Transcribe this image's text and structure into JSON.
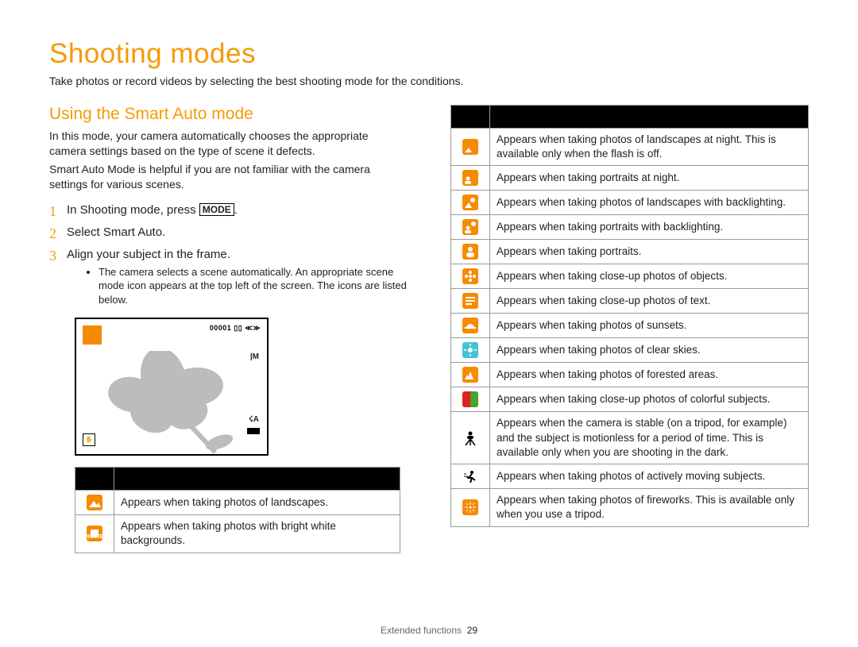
{
  "title": "Shooting modes",
  "subtitle": "Take photos or record videos by selecting the best shooting mode for the conditions.",
  "section": "Using the Smart Auto mode",
  "para1": "In this mode, your camera automatically chooses the appropriate camera settings based on the type of scene it defects.",
  "para2": "Smart Auto Mode is helpful if you are not familiar with the camera settings for various scenes.",
  "steps": {
    "s1a": "In Shooting mode, press ",
    "s1b": "MODE",
    "s1c": ".",
    "s2": "Select Smart Auto.",
    "s3": "Align your subject in the frame.",
    "bullet": "The camera selects a scene automatically. An appropriate scene mode icon appears at the top left of the screen. The icons are listed below."
  },
  "screen": {
    "top_status": "00001 ▯▯ ≪≫",
    "right1": "|M",
    "right2": "☇A",
    "bl": "✋"
  },
  "table_left": [
    {
      "icon_name": "landscape-icon",
      "icon_class": "ico-orange",
      "svg_kind": "landscape",
      "desc": "Appears when taking photos of landscapes."
    },
    {
      "icon_name": "white-bg-icon",
      "icon_class": "ico-orange",
      "svg_kind": "white",
      "desc": "Appears when taking photos with bright white backgrounds."
    }
  ],
  "table_right": [
    {
      "icon_name": "night-landscape-icon",
      "icon_class": "ico-orange",
      "svg_kind": "moon-landscape",
      "desc": "Appears when taking photos of landscapes at night. This is available only when the flash is off."
    },
    {
      "icon_name": "night-portrait-icon",
      "icon_class": "ico-orange",
      "svg_kind": "moon-portrait",
      "desc": "Appears when taking portraits at night."
    },
    {
      "icon_name": "backlight-landscape-icon",
      "icon_class": "ico-orange",
      "svg_kind": "sun-landscape",
      "desc": "Appears when taking photos of landscapes with backlighting."
    },
    {
      "icon_name": "backlight-portrait-icon",
      "icon_class": "ico-orange",
      "svg_kind": "sun-portrait",
      "desc": "Appears when taking portraits with backlighting."
    },
    {
      "icon_name": "portrait-icon",
      "icon_class": "ico-orange",
      "svg_kind": "portrait",
      "desc": "Appears when taking portraits."
    },
    {
      "icon_name": "macro-object-icon",
      "icon_class": "ico-orange",
      "svg_kind": "flower",
      "desc": "Appears when taking close-up photos of objects."
    },
    {
      "icon_name": "macro-text-icon",
      "icon_class": "ico-orange",
      "svg_kind": "text",
      "desc": "Appears when taking close-up photos of text."
    },
    {
      "icon_name": "sunset-icon",
      "icon_class": "ico-orange",
      "svg_kind": "sunset",
      "desc": "Appears when taking photos of sunsets."
    },
    {
      "icon_name": "clear-sky-icon",
      "icon_class": "ico-cyan",
      "svg_kind": "sky",
      "desc": "Appears when taking photos of clear skies."
    },
    {
      "icon_name": "forest-icon",
      "icon_class": "ico-orange",
      "svg_kind": "forest",
      "desc": "Appears when taking photos of forested areas."
    },
    {
      "icon_name": "macro-color-icon",
      "icon_class": "ico-green",
      "svg_kind": "",
      "desc": "Appears when taking close-up photos of colorful subjects."
    },
    {
      "icon_name": "tripod-icon",
      "icon_class": "ico-plain",
      "svg_kind": "tripod",
      "desc": "Appears when the camera is stable (on a tripod, for example) and the subject is motionless for a period of time. This is available only when you are shooting in the dark."
    },
    {
      "icon_name": "action-icon",
      "icon_class": "ico-plain",
      "svg_kind": "action",
      "desc": "Appears when taking photos of actively moving subjects."
    },
    {
      "icon_name": "fireworks-icon",
      "icon_class": "ico-orange",
      "svg_kind": "fireworks",
      "desc": "Appears when taking photos of fireworks. This is available only when you use a tripod."
    }
  ],
  "footer_label": "Extended functions",
  "footer_page": "29"
}
